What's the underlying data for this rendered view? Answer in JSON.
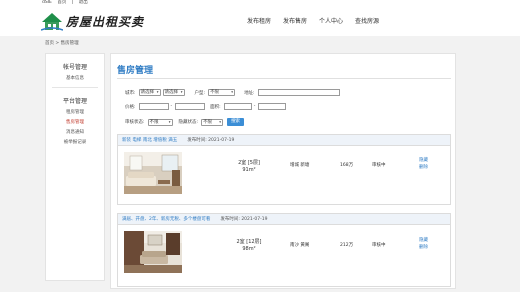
{
  "topbar": {
    "user": "dSIE",
    "home": "首页",
    "pipe": "|",
    "logout": "退出"
  },
  "header": {
    "brand": "房屋出租买卖"
  },
  "nav": [
    {
      "label": "发布租房"
    },
    {
      "label": "发布售房"
    },
    {
      "label": "个人中心"
    },
    {
      "label": "查找房源"
    }
  ],
  "breadcrumb": "首页 > 售房管理",
  "sidebar": {
    "sections": [
      {
        "title": "帐号管理",
        "items": [
          "基本信息"
        ]
      },
      {
        "title": "平台管理",
        "items": [
          "租房管理",
          "售房管理",
          "消息通知",
          "被举报记录"
        ]
      }
    ],
    "active": "售房管理"
  },
  "page_title": "售房管理",
  "filters": {
    "city_label": "城市:",
    "province_select": "请选择",
    "city_select": "请选择",
    "layout_label": "户型:",
    "layout_select": "不限",
    "address_label": "地址:",
    "price_label": "价格:",
    "range_sep": "-",
    "area_label": "面积:",
    "audit_label": "审核状态:",
    "audit_select": "不限",
    "hidden_label": "隐藏状态:",
    "hidden_select": "不限",
    "search_button": "搜索"
  },
  "listings": [
    {
      "tags": "新装 电梯 南北 增值税 满五",
      "published": "发布时间: 2021-07-19",
      "rooms": "2室 [5层]",
      "area": "91m²",
      "location": "增城 新塘",
      "price": "168万",
      "status": "审核中",
      "actions": [
        "隐藏",
        "删除"
      ]
    },
    {
      "tags": "满居、开盘、2年、新房无税、多个楼盘可看",
      "published": "发布时间: 2021-07-19",
      "rooms": "2室 [12层]",
      "area": "98m²",
      "location": "南沙 黄阁",
      "price": "212万",
      "status": "审核中",
      "actions": [
        "隐藏",
        "删除"
      ]
    }
  ],
  "colors": {
    "accent": "#2f7cc4",
    "active_menu": "#c0392b",
    "button": "#3b8ed6",
    "card_header": "#eef3f9"
  }
}
